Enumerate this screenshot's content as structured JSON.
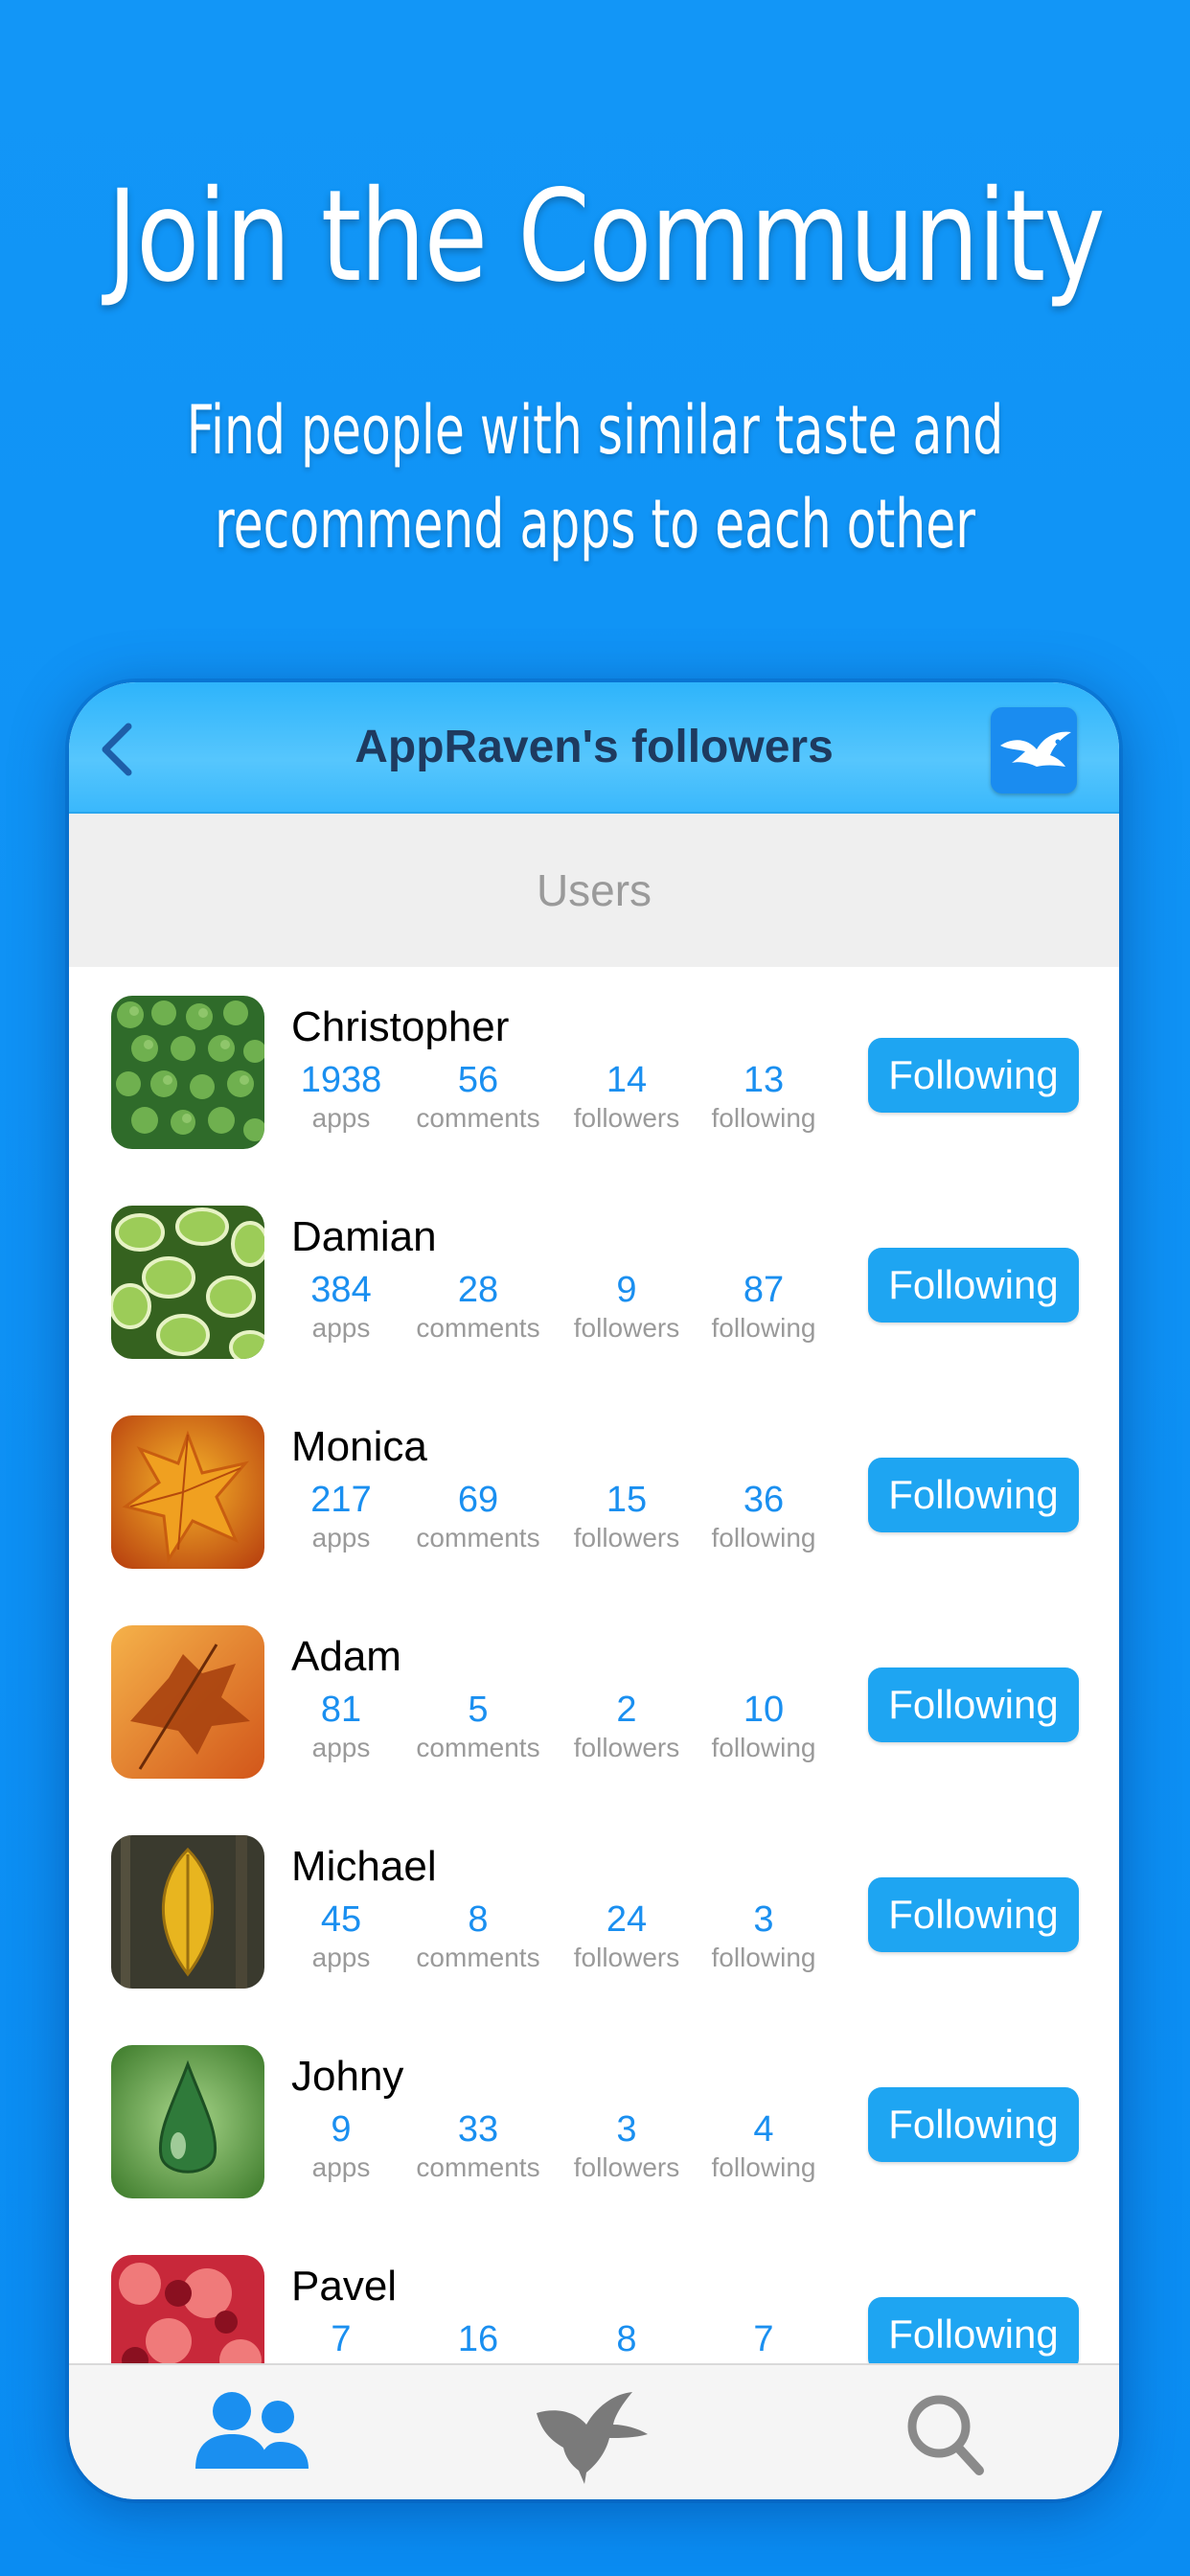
{
  "marketing": {
    "headline": "Join the Community",
    "subhead_line1": "Find people with similar taste and",
    "subhead_line2": "recommend apps to each other"
  },
  "navbar": {
    "title": "AppRaven's followers",
    "back_icon": "chevron-left-icon",
    "logo_icon": "raven-logo-icon"
  },
  "section": {
    "header": "Users"
  },
  "stat_labels": {
    "apps": "apps",
    "comments": "comments",
    "followers": "followers",
    "following": "following"
  },
  "users": [
    {
      "name": "Christopher",
      "apps": "1938",
      "comments": "56",
      "followers": "14",
      "following": "13",
      "button": "Following"
    },
    {
      "name": "Damian",
      "apps": "384",
      "comments": "28",
      "followers": "9",
      "following": "87",
      "button": "Following"
    },
    {
      "name": "Monica",
      "apps": "217",
      "comments": "69",
      "followers": "15",
      "following": "36",
      "button": "Following"
    },
    {
      "name": "Adam",
      "apps": "81",
      "comments": "5",
      "followers": "2",
      "following": "10",
      "button": "Following"
    },
    {
      "name": "Michael",
      "apps": "45",
      "comments": "8",
      "followers": "24",
      "following": "3",
      "button": "Following"
    },
    {
      "name": "Johny",
      "apps": "9",
      "comments": "33",
      "followers": "3",
      "following": "4",
      "button": "Following"
    },
    {
      "name": "Pavel",
      "apps": "7",
      "comments": "16",
      "followers": "8",
      "following": "7",
      "button": "Following"
    }
  ],
  "tabbar": {
    "tabs": [
      {
        "icon": "people-icon",
        "active": true
      },
      {
        "icon": "raven-icon",
        "active": false
      },
      {
        "icon": "search-icon",
        "active": false
      }
    ]
  },
  "colors": {
    "background": "#0a8ff5",
    "accent": "#1ea5f2",
    "stat_number": "#1a8ff0"
  }
}
